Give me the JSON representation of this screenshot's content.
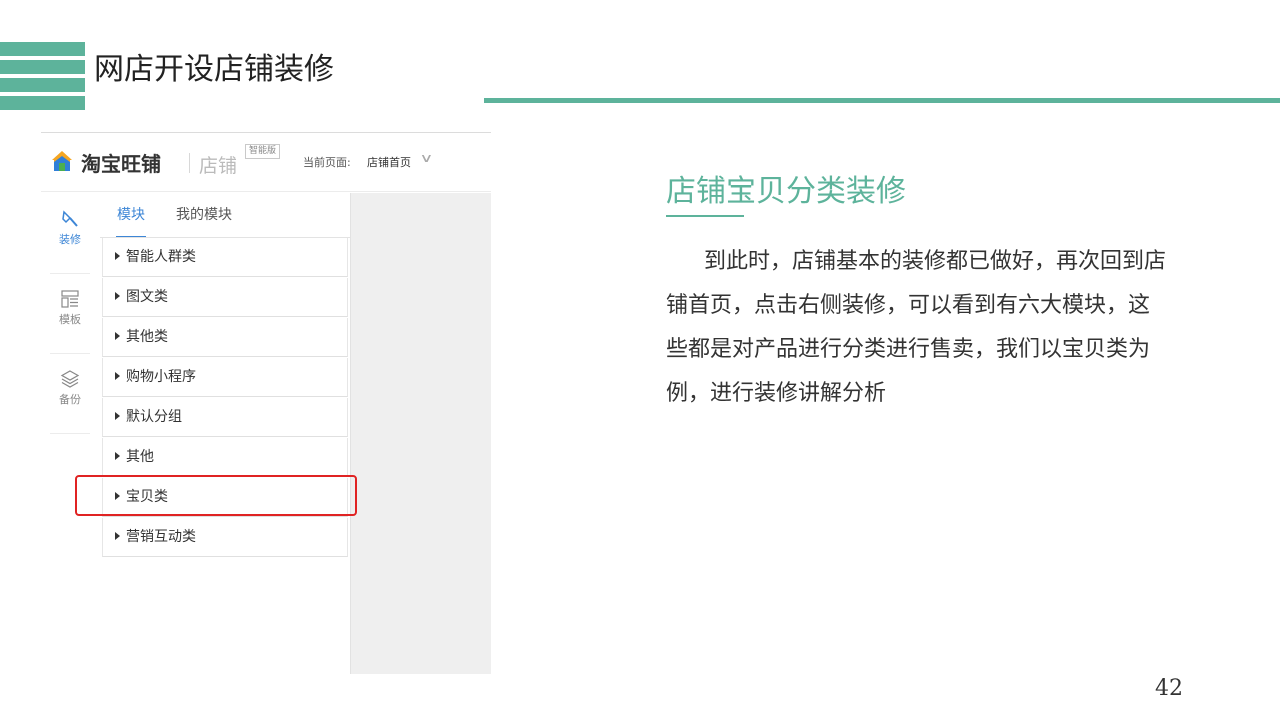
{
  "slide": {
    "title": "网店开设店铺装修",
    "section_title": "店铺宝贝分类装修",
    "body": "到此时，店铺基本的装修都已做好，再次回到店铺首页，点击右侧装修，可以看到有六大模块，这些都是对产品进行分类进行售卖，我们以宝贝类为例，进行装修讲解分析",
    "page_number": "42",
    "accent_color": "#5db39b"
  },
  "screenshot": {
    "brand": "淘宝旺铺",
    "brand_sub": "店铺",
    "badge": "智能版",
    "current_page_label": "当前页面:",
    "current_page_value": "店铺首页",
    "left_nav": [
      {
        "label": "装修",
        "icon": "hammer-icon",
        "active": true
      },
      {
        "label": "模板",
        "icon": "template-icon",
        "active": false
      },
      {
        "label": "备份",
        "icon": "layers-icon",
        "active": false
      }
    ],
    "tabs": [
      {
        "label": "模块",
        "active": true
      },
      {
        "label": "我的模块",
        "active": false
      }
    ],
    "categories": [
      "智能人群类",
      "图文类",
      "其他类",
      "购物小程序",
      "默认分组",
      "其他",
      "宝贝类",
      "营销互动类"
    ],
    "highlighted_category": "宝贝类",
    "highlight_color": "#e02323",
    "active_color": "#3d86d6"
  }
}
